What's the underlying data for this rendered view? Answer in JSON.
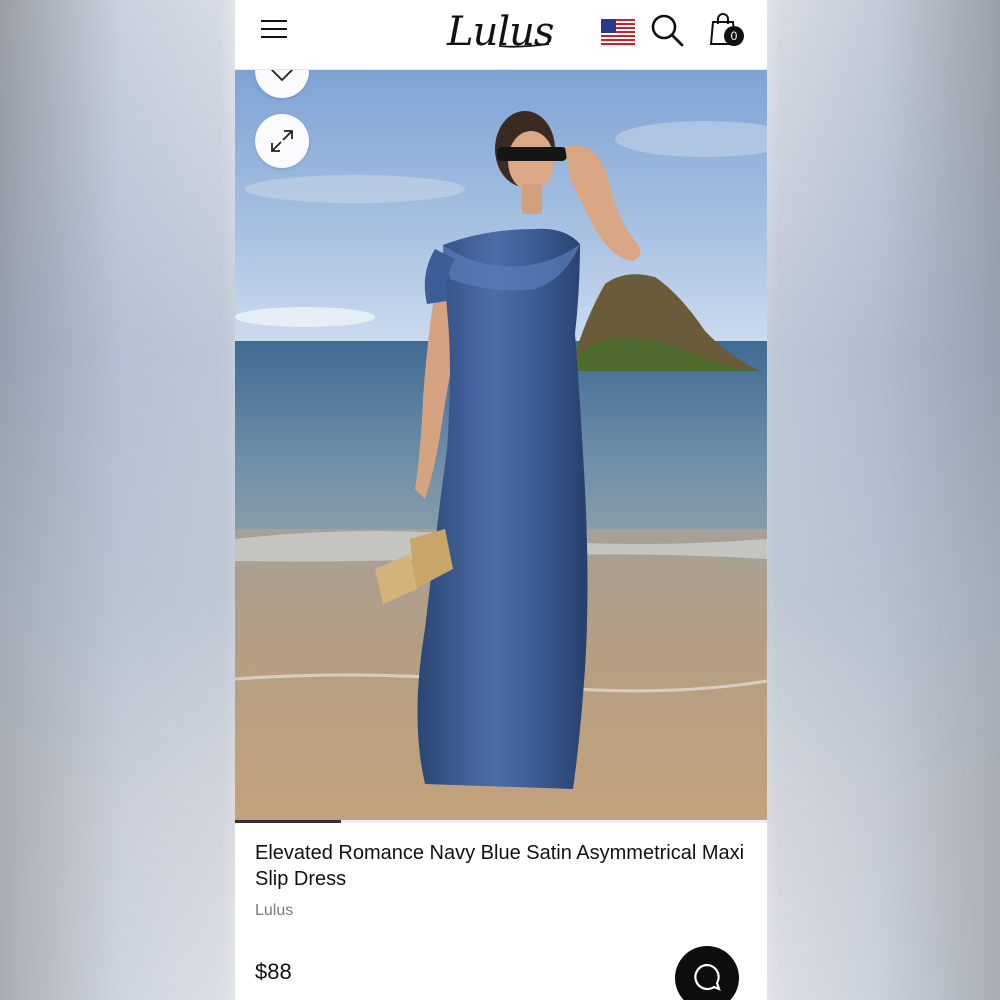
{
  "header": {
    "logo_text": "Lulus",
    "cart_count": "0",
    "icons": [
      "menu-icon",
      "us-flag-icon",
      "search-icon",
      "shopping-bag-icon"
    ]
  },
  "gallery": {
    "buttons": [
      "heart-icon",
      "expand-icon"
    ],
    "current_image_progress": 0.2
  },
  "product": {
    "title": "Elevated Romance Navy Blue Satin Asymmetrical Maxi Slip Dress",
    "brand": "Lulus",
    "price": "$88"
  },
  "chat": {
    "icon": "chat-bubble-icon"
  },
  "colors": {
    "dress": "#3b5b94",
    "text": "#111111",
    "muted": "#7a7a7a"
  }
}
